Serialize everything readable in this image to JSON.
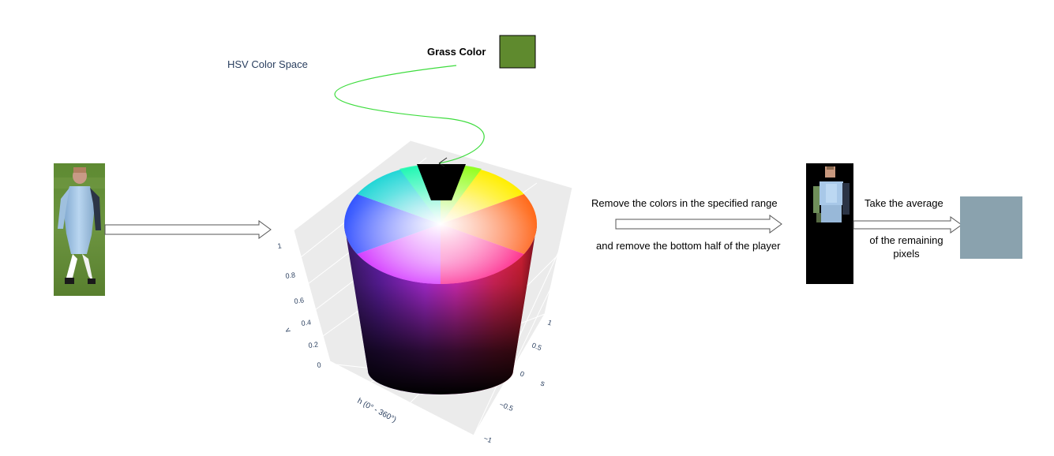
{
  "plot": {
    "title": "HSV Color Space",
    "axes": {
      "v": {
        "label": "v",
        "ticks": [
          "0",
          "0.2",
          "0.4",
          "0.6",
          "0.8",
          "1"
        ]
      },
      "s": {
        "label": "s",
        "ticks": [
          "−1",
          "−0.5",
          "0",
          "0.5",
          "1"
        ]
      },
      "h": {
        "label": "h (0° - 360°)"
      }
    }
  },
  "grass": {
    "label": "Grass Color",
    "color": "#5f8a2e"
  },
  "steps": {
    "remove_line1": "Remove the colors in the specified range",
    "remove_line2": "and remove the bottom half of the player",
    "average_line1": "Take the average",
    "average_line2": "of the remaining",
    "average_line3": "pixels"
  },
  "colors": {
    "field": "#6a8f3a",
    "jersey": "#a8c8e8",
    "masked_background": "#000000",
    "result": "#8aa2ae",
    "curve": "#3ddc3d"
  },
  "icons": [
    "player-photo",
    "masked-player-photo",
    "arrow-icon",
    "hsv-cylinder",
    "grass-swatch",
    "result-swatch"
  ]
}
